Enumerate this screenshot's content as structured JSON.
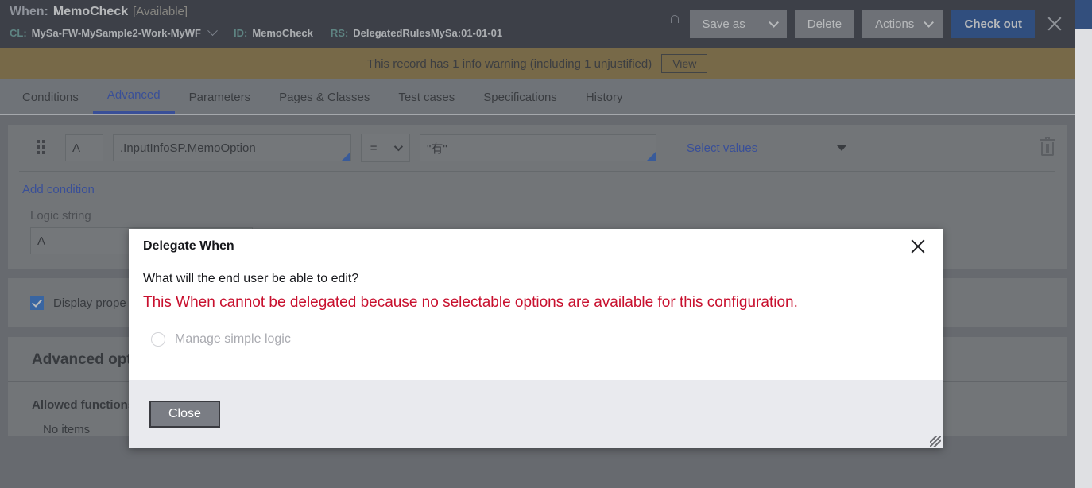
{
  "header": {
    "when_label": "When:",
    "rule_name": "MemoCheck",
    "availability": "[Available]",
    "cl_label": "CL:",
    "cl_value": "MySa-FW-MySample2-Work-MyWF",
    "id_label": "ID:",
    "id_value": "MemoCheck",
    "rs_label": "RS:",
    "rs_value": "DelegatedRulesMySa:01-01-01",
    "lock_icon": "lock-icon",
    "save_as": "Save as",
    "delete": "Delete",
    "actions": "Actions",
    "check_out": "Check out",
    "close_icon": "close-icon",
    "accent_primary": "#0a3d91"
  },
  "warning": {
    "message": "This record has 1 info warning (including 1 unjustified)",
    "view_label": "View",
    "background": "#8a6d2f"
  },
  "tabs": {
    "active": "Advanced",
    "items": [
      {
        "label": "Conditions"
      },
      {
        "label": "Advanced"
      },
      {
        "label": "Parameters"
      },
      {
        "label": "Pages & Classes"
      },
      {
        "label": "Test cases"
      },
      {
        "label": "Specifications"
      },
      {
        "label": "History"
      }
    ],
    "active_color": "#1a3fbf"
  },
  "conditions": {
    "drag_handle_icon": "drag-handle-icon",
    "row": {
      "label": "A",
      "property": ".InputInfoSP.MemoOption",
      "operator": "=",
      "value": "\"有\"",
      "select_values_link": "Select values",
      "dropdown_caret_icon": "chevron-down-icon",
      "delete_icon": "trash-icon"
    },
    "add_condition": "Add condition",
    "logic_string_label": "Logic string",
    "logic_string_value": "A",
    "smart_corner_color": "#1a55c4",
    "link_color": "#1a3fbf"
  },
  "display": {
    "checkbox_checked": true,
    "label": "Display prope",
    "checkbox_color": "#1a66d0"
  },
  "advanced": {
    "title": "Advanced opt",
    "allowed_functions_label": "Allowed functions",
    "no_items": "No items"
  },
  "modal": {
    "title": "Delegate When",
    "close_icon": "close-icon",
    "question": "What will the end user be able to edit?",
    "error": "This When cannot be delegated because no selectable options are available for this configuration.",
    "error_color": "#c8102e",
    "radio_label": "Manage simple logic",
    "radio_disabled": true,
    "close_button": "Close",
    "resize_grip_icon": "resize-grip-icon"
  }
}
